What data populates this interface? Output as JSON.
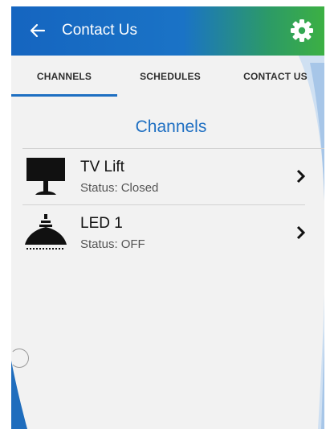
{
  "app": {
    "title": "Contact Us",
    "accent_color": "#1e6fc2",
    "header_gradient": [
      "#1565c0",
      "#3cb043"
    ],
    "icons": {
      "back": "arrow-left-icon",
      "settings": "gear-icon",
      "row_action": "chevron-right-icon"
    }
  },
  "tabs": [
    {
      "label": "CHANNELS",
      "active": true
    },
    {
      "label": "SCHEDULES",
      "active": false
    },
    {
      "label": "CONTACT US",
      "active": false
    }
  ],
  "section": {
    "title": "Channels"
  },
  "channels": [
    {
      "name": "TV Lift",
      "status_label": "Status:",
      "status_value": "Closed",
      "icon": "tv-lift-icon"
    },
    {
      "name": "LED 1",
      "status_label": "Status:",
      "status_value": "OFF",
      "icon": "led-lamp-icon"
    }
  ]
}
